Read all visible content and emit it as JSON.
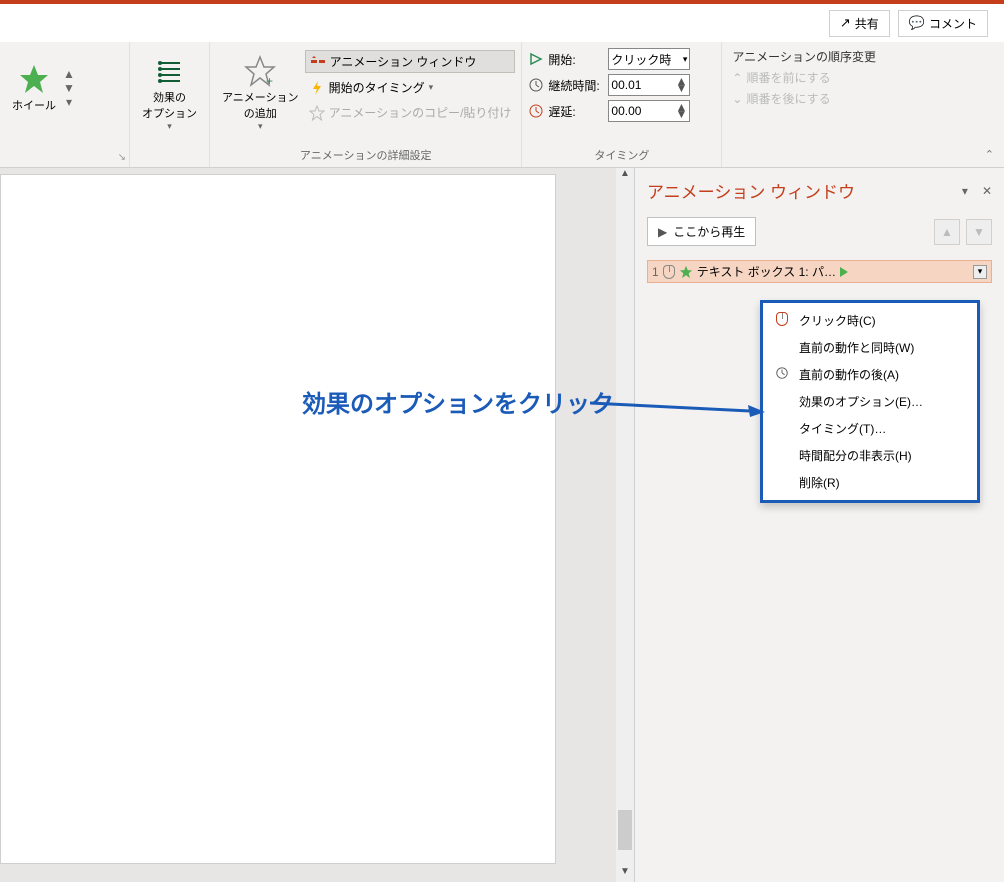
{
  "topbar": {
    "share": "共有",
    "comment": "コメント"
  },
  "ribbon": {
    "wheel": "ホイール",
    "effect_options": "効果の\nオプション",
    "add_animation": "アニメーション\nの追加",
    "anim_window": "アニメーション ウィンドウ",
    "start_timing": "開始のタイミング",
    "copy_paste": "アニメーションのコピー/貼り付け",
    "grp_advanced": "アニメーションの詳細設定",
    "start_label": "開始:",
    "start_value": "クリック時",
    "duration_label": "継続時間:",
    "duration_value": "00.01",
    "delay_label": "遅延:",
    "delay_value": "00.00",
    "grp_timing": "タイミング",
    "reorder_hdr": "アニメーションの順序変更",
    "move_earlier": "順番を前にする",
    "move_later": "順番を後にする"
  },
  "pane": {
    "title": "アニメーション ウィンドウ",
    "play": "ここから再生"
  },
  "anim_item": {
    "num": "1",
    "name": "テキスト ボックス 1: パ…"
  },
  "ctx": {
    "on_click": "クリック時(C)",
    "with_prev": "直前の動作と同時(W)",
    "after_prev": "直前の動作の後(A)",
    "effect_opts": "効果のオプション(E)…",
    "timing": "タイミング(T)…",
    "hide_timeline": "時間配分の非表示(H)",
    "remove": "削除(R)"
  },
  "annotation": "効果のオプションをクリック"
}
